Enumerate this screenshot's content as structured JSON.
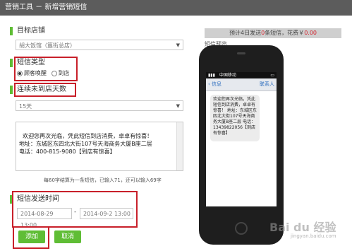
{
  "header": {
    "title": "营销工具 － 新增营销短信"
  },
  "store": {
    "label": "目标店铺",
    "selected": "胡大饭馆（簋街总店）"
  },
  "sms_type": {
    "label": "短信类型",
    "options": [
      "顾客唤醒",
      "到店"
    ],
    "selected_index": 0
  },
  "days": {
    "label": "连续未到店天数",
    "selected": "15天"
  },
  "message": {
    "content": "欢迎您再次光临，凭此短信到店消费，卓卓有惊喜！\n地址：东城区东四北大街107号天海商务大厦B座二层\n电话：400-815-9080【到店有惊喜】",
    "counter": "每60字结算为一条短信，已输入71，还可以输入69字"
  },
  "send_time": {
    "label": "短信发送时间",
    "start": "2014-08-29 13:00",
    "separator": "-",
    "end": "2014-09-2 13:00"
  },
  "buttons": {
    "add": "添加",
    "cancel": "取消"
  },
  "estimate": {
    "prefix": "预计4日发送",
    "count": "0",
    "middle": "条短信，花费￥",
    "cost": "0.00",
    "count_color": "#d2252f"
  },
  "preview": {
    "label": "短信预览",
    "carrier": "中国移动",
    "back": "信息",
    "contact": "联系人",
    "bubble": "欢迎您再次光临，凭此短信到店消费，卓卓有惊喜！ 地址：东城区东四北大街107号天海商务大厦B座二层 电话：13439822056【到店有惊喜】"
  },
  "watermark": {
    "text": "Bai du 经验",
    "sub": "jingyan.baidu.com"
  }
}
